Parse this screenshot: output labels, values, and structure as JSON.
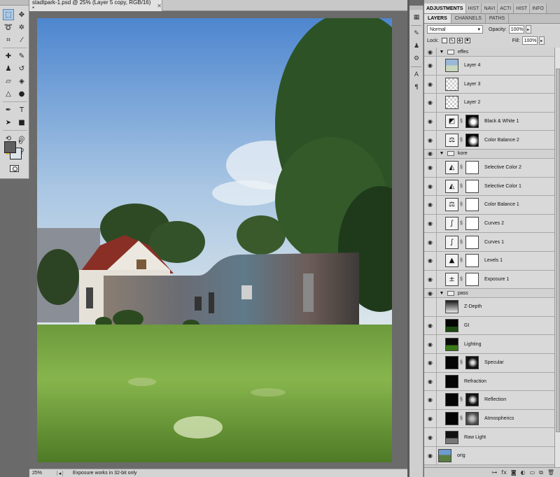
{
  "document": {
    "tab_title": "stadtpark-1.psd @ 25% (Layer 5 copy, RGB/16) *",
    "zoom": "25%",
    "status_text": "Exposure works in 32-bit only"
  },
  "panel": {
    "top_tabs": [
      "ADJUSTMENTS",
      "HIST",
      "NAVI",
      "ACTI",
      "HIST",
      "INFO"
    ],
    "sub_tabs": [
      "LAYERS",
      "CHANNELS",
      "PATHS"
    ],
    "blend_mode": "Normal",
    "opacity_label": "Opacity:",
    "opacity_value": "100%",
    "lock_label": "Lock:",
    "fill_label": "Fill:",
    "fill_value": "100%"
  },
  "layers": [
    {
      "name": "effes",
      "type": "group",
      "visible": true
    },
    {
      "name": "Layer 4",
      "type": "pixel",
      "visible": true
    },
    {
      "name": "Layer 3",
      "type": "pixel",
      "visible": true
    },
    {
      "name": "Layer 2",
      "type": "pixel",
      "visible": true
    },
    {
      "name": "Black & White 1",
      "type": "adjustment",
      "visible": true
    },
    {
      "name": "Color Balance 2",
      "type": "adjustment",
      "visible": true
    },
    {
      "name": "kore",
      "type": "group",
      "visible": true
    },
    {
      "name": "Selective Color 2",
      "type": "adjustment",
      "visible": true
    },
    {
      "name": "Selective Color 1",
      "type": "adjustment",
      "visible": true
    },
    {
      "name": "Color Balance 1",
      "type": "adjustment",
      "visible": true
    },
    {
      "name": "Curves 2",
      "type": "adjustment",
      "visible": true
    },
    {
      "name": "Curves 1",
      "type": "adjustment",
      "visible": true
    },
    {
      "name": "Levels 1",
      "type": "adjustment",
      "visible": true
    },
    {
      "name": "Exposure 1",
      "type": "adjustment",
      "visible": true
    },
    {
      "name": "pass",
      "type": "group",
      "visible": true
    },
    {
      "name": "Z-Depth",
      "type": "pixel",
      "visible": false
    },
    {
      "name": "GI",
      "type": "pixel",
      "visible": true
    },
    {
      "name": "Lighting",
      "type": "pixel",
      "visible": true
    },
    {
      "name": "Specular",
      "type": "masked",
      "visible": true
    },
    {
      "name": "Refraction",
      "type": "pixel",
      "visible": true
    },
    {
      "name": "Reflection",
      "type": "masked",
      "visible": true
    },
    {
      "name": "Atmospherics",
      "type": "masked",
      "visible": true
    },
    {
      "name": "Raw Light",
      "type": "pixel",
      "visible": true
    },
    {
      "name": "orig",
      "type": "pixel",
      "visible": true
    }
  ],
  "icons": {
    "visibility": "eye-icon",
    "link": "chain-link-icon",
    "folder": "folder-icon"
  }
}
